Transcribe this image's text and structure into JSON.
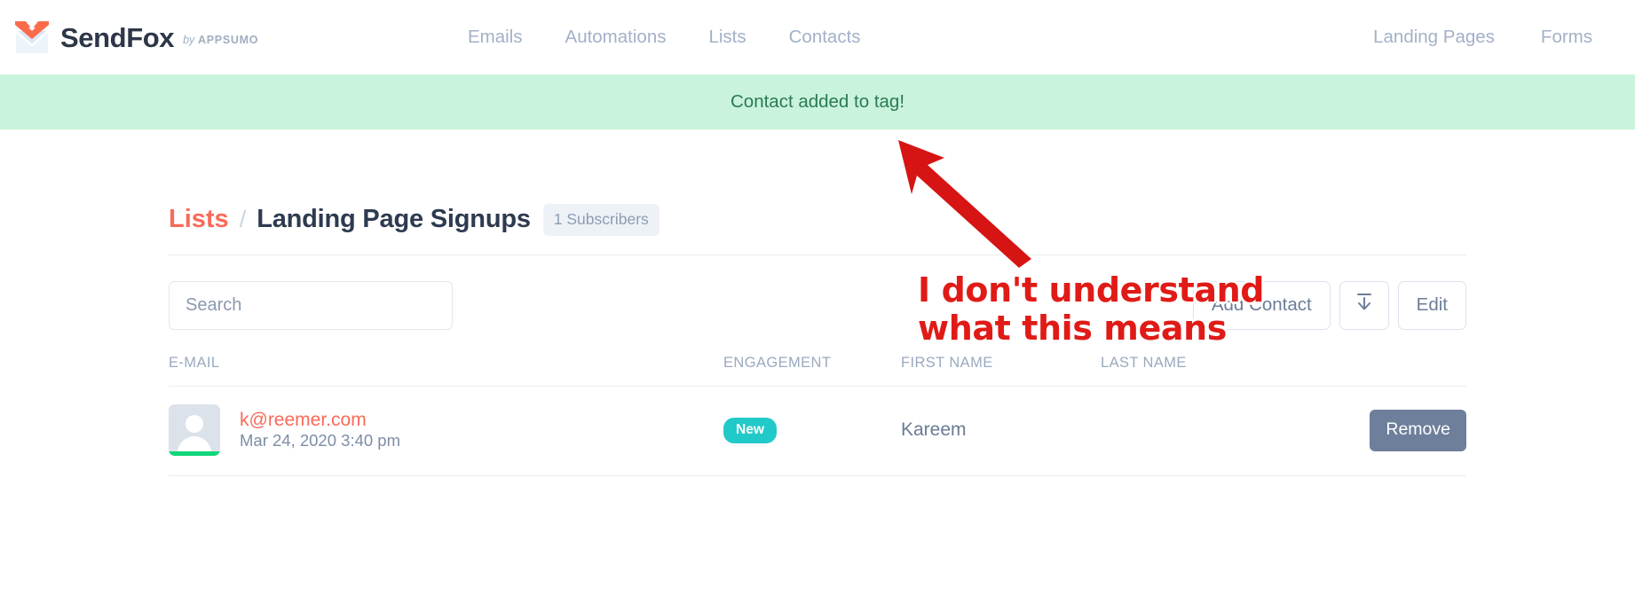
{
  "brand": {
    "name": "SendFox",
    "by_prefix": "by",
    "by_company": "APPSUMO",
    "logo_icon": "sendfox-fox-envelope-logo"
  },
  "nav": {
    "center_links": [
      {
        "label": "Emails",
        "name": "nav-link-emails"
      },
      {
        "label": "Automations",
        "name": "nav-link-automations"
      },
      {
        "label": "Lists",
        "name": "nav-link-lists"
      },
      {
        "label": "Contacts",
        "name": "nav-link-contacts"
      }
    ],
    "right_links": [
      {
        "label": "Landing Pages",
        "name": "nav-link-landing-pages"
      },
      {
        "label": "Forms",
        "name": "nav-link-forms"
      }
    ]
  },
  "alert": {
    "message": "Contact added to tag!",
    "bg_color": "#c9f3dc",
    "text_color": "#2a7a52"
  },
  "breadcrumb": {
    "parent": "Lists",
    "separator": "/",
    "title": "Landing Page Signups",
    "subscriber_badge": "1 Subscribers"
  },
  "toolbar": {
    "search_placeholder": "Search",
    "search_value": "",
    "add_contact_label": "Add Contact",
    "download_icon": "download-icon",
    "edit_label": "Edit"
  },
  "table": {
    "headers": [
      "E-MAIL",
      "ENGAGEMENT",
      "FIRST NAME",
      "LAST NAME",
      ""
    ],
    "rows": [
      {
        "avatar_icon": "user-avatar-placeholder",
        "email": "k@reemer.com",
        "date": "Mar 24, 2020 3:40 pm",
        "engagement": "New",
        "first_name": "Kareem",
        "last_name": "",
        "action_label": "Remove"
      }
    ]
  },
  "annotation": {
    "line1": "I don't understand",
    "line2": "what this means",
    "color": "#e01b17",
    "arrow_icon": "red-arrow-pointing-up-left"
  },
  "colors": {
    "brand_coral": "#f96a5a",
    "nav_text": "#a3b0c8",
    "badge_teal": "#22c9c9",
    "remove_slate": "#6d7f9b"
  }
}
